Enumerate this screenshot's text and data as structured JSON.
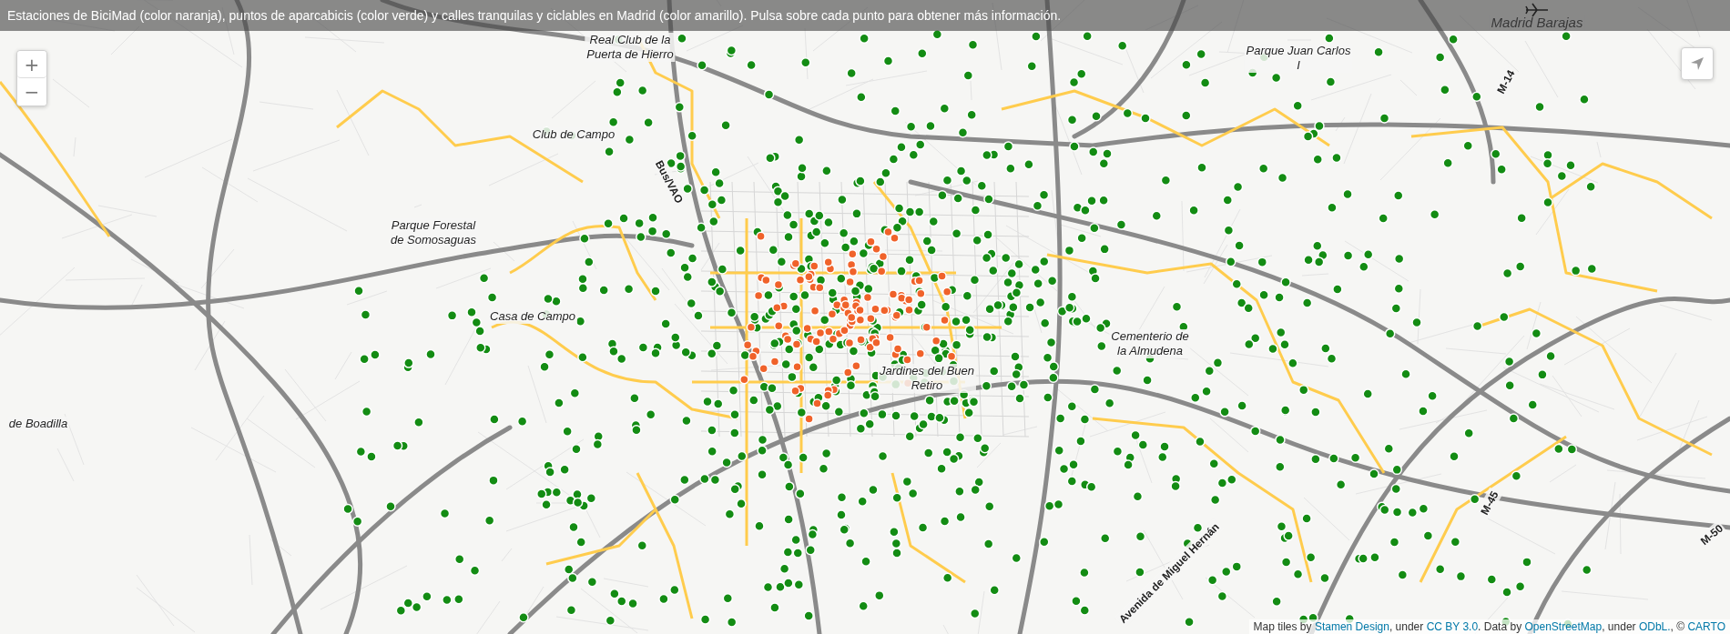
{
  "banner": {
    "text": "Estaciones de BiciMad (color naranja), puntos de aparcabicis (color verde) y calles tranquilas y ciclables en Madrid (color amarillo). Pulsa sobre cada punto para obtener más información."
  },
  "zoom_controls": {
    "zoom_in": "+",
    "zoom_out": "−"
  },
  "map_labels": [
    {
      "kind": "place",
      "lines": [
        "Real Club de la",
        "Puerta de Hierro"
      ]
    },
    {
      "kind": "place",
      "lines": [
        "Club de Campo"
      ]
    },
    {
      "kind": "road",
      "lines": [
        "Bus/VAO"
      ]
    },
    {
      "kind": "place",
      "lines": [
        "Parque Forestal",
        "de Somosaguas"
      ]
    },
    {
      "kind": "place",
      "lines": [
        "Casa de Campo"
      ]
    },
    {
      "kind": "place",
      "lines": [
        "de Boadilla"
      ]
    },
    {
      "kind": "place",
      "lines": [
        "Jardines del Buen",
        "Retiro"
      ]
    },
    {
      "kind": "place",
      "lines": [
        "Cementerio de",
        "la Almudena"
      ]
    },
    {
      "kind": "place",
      "lines": [
        "Parque Juan Carlos",
        "I"
      ]
    },
    {
      "kind": "airport",
      "lines": [
        "Madrid Barajas"
      ]
    },
    {
      "kind": "road",
      "lines": [
        "M-14"
      ]
    },
    {
      "kind": "road",
      "lines": [
        "M-45"
      ]
    },
    {
      "kind": "road",
      "lines": [
        "M-50"
      ]
    },
    {
      "kind": "road",
      "lines": [
        "Avenida de Miguel Hernán"
      ]
    }
  ],
  "attribution": [
    {
      "kind": "text",
      "text": "Map tiles by "
    },
    {
      "kind": "link",
      "text": "Stamen Design"
    },
    {
      "kind": "text",
      "text": ", under "
    },
    {
      "kind": "link",
      "text": "CC BY 3.0"
    },
    {
      "kind": "text",
      "text": ". Data by "
    },
    {
      "kind": "link",
      "text": "OpenStreetMap"
    },
    {
      "kind": "text",
      "text": ", under "
    },
    {
      "kind": "link",
      "text": "ODbL."
    },
    {
      "kind": "text",
      "text": ", © "
    },
    {
      "kind": "link",
      "text": "CARTO"
    }
  ]
}
